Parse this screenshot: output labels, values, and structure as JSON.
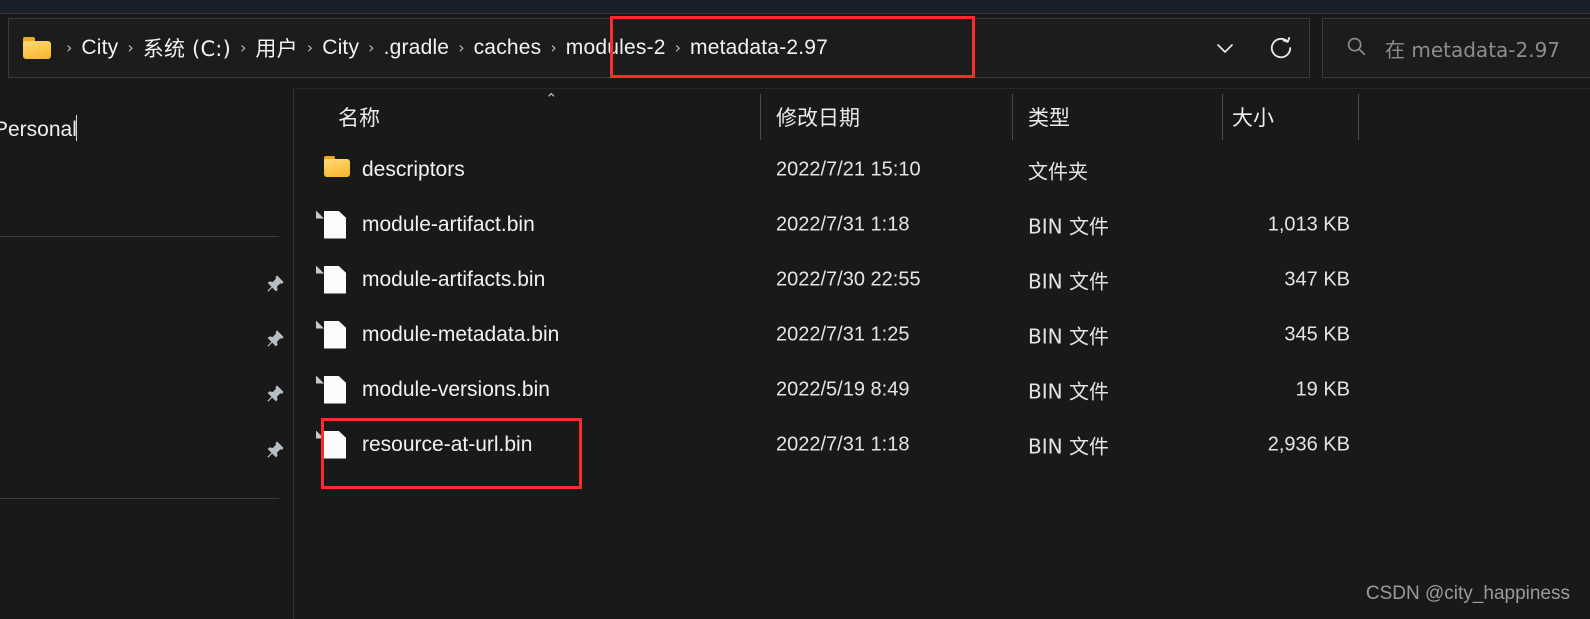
{
  "window": {
    "theme_bg": "#191919",
    "accent_highlight": "#fb2c2c"
  },
  "addressbar": {
    "folder_icon": "folder-icon",
    "separator": "›",
    "crumbs": [
      {
        "label": "City"
      },
      {
        "label": "系统 (C:)"
      },
      {
        "label": "用户"
      },
      {
        "label": "City"
      },
      {
        "label": ".gradle"
      },
      {
        "label": "caches"
      },
      {
        "label": "modules-2"
      },
      {
        "label": "metadata-2.97"
      }
    ],
    "dropdown_icon": "chevron-down-icon",
    "refresh_icon": "refresh-icon"
  },
  "search": {
    "icon": "search-icon",
    "placeholder": "在 metadata-2.97"
  },
  "sidebar": {
    "label": "Personal",
    "pin_icon": "pin-icon",
    "pin_count": 4
  },
  "columns": {
    "name": "名称",
    "date_modified": "修改日期",
    "type": "类型",
    "size": "大小",
    "sort_indicator": "⌃"
  },
  "files": [
    {
      "icon": "folder-icon",
      "name": "descriptors",
      "date": "2022/7/21 15:10",
      "type": "文件夹",
      "size": ""
    },
    {
      "icon": "file-icon",
      "name": "module-artifact.bin",
      "date": "2022/7/31 1:18",
      "type": "BIN 文件",
      "size": "1,013 KB"
    },
    {
      "icon": "file-icon",
      "name": "module-artifacts.bin",
      "date": "2022/7/30 22:55",
      "type": "BIN 文件",
      "size": "347 KB"
    },
    {
      "icon": "file-icon",
      "name": "module-metadata.bin",
      "date": "2022/7/31 1:25",
      "type": "BIN 文件",
      "size": "345 KB"
    },
    {
      "icon": "file-icon",
      "name": "module-versions.bin",
      "date": "2022/5/19 8:49",
      "type": "BIN 文件",
      "size": "19 KB"
    },
    {
      "icon": "file-icon",
      "name": "resource-at-url.bin",
      "date": "2022/7/31 1:18",
      "type": "BIN 文件",
      "size": "2,936 KB"
    }
  ],
  "watermark": {
    "text": "CSDN @city_happiness"
  }
}
